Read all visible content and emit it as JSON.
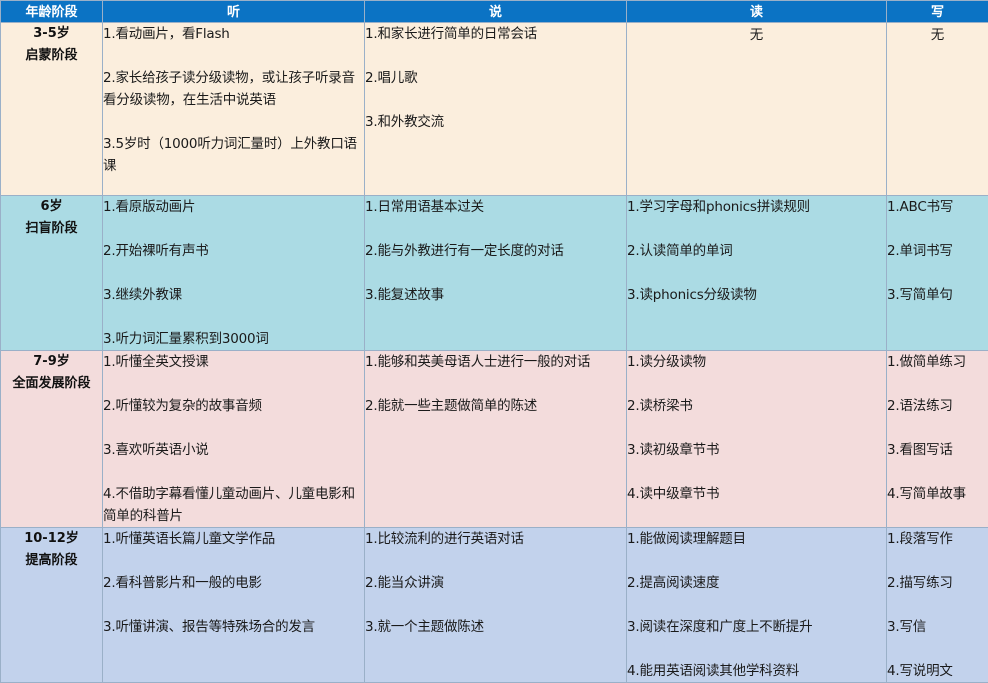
{
  "header": [
    "年龄阶段",
    "听",
    "说",
    "读",
    "写"
  ],
  "rows": [
    {
      "stage": [
        "3-5岁",
        "启蒙阶段"
      ],
      "listen": [
        "1.看动画片，看Flash",
        "2.家长给孩子读分级读物，或让孩子听录音看分级读物，在生活中说英语",
        "3.5岁时（1000听力词汇量时）上外教口语课"
      ],
      "speak": [
        "1.和家长进行简单的日常会话",
        "2.唱儿歌",
        "3.和外教交流"
      ],
      "read": [
        "无"
      ],
      "write": [
        "无"
      ]
    },
    {
      "stage": [
        "6岁",
        "扫盲阶段"
      ],
      "listen": [
        "1.看原版动画片",
        "2.开始裸听有声书",
        "3.继续外教课",
        "3.听力词汇量累积到3000词"
      ],
      "speak": [
        "1.日常用语基本过关",
        "2.能与外教进行有一定长度的对话",
        "3.能复述故事"
      ],
      "read": [
        "1.学习字母和phonics拼读规则",
        "2.认读简单的单词",
        "3.读phonics分级读物"
      ],
      "write": [
        "1.ABC书写",
        "2.单词书写",
        "3.写简单句"
      ]
    },
    {
      "stage": [
        "7-9岁",
        "全面发展阶段"
      ],
      "listen": [
        "1.听懂全英文授课",
        "2.听懂较为复杂的故事音频",
        "3.喜欢听英语小说",
        "4.不借助字幕看懂儿童动画片、儿童电影和简单的科普片"
      ],
      "speak": [
        "1.能够和英美母语人士进行一般的对话",
        "2.能就一些主题做简单的陈述"
      ],
      "read": [
        "1.读分级读物",
        "2.读桥梁书",
        "3.读初级章节书",
        "4.读中级章节书"
      ],
      "write": [
        "1.做简单练习",
        "2.语法练习",
        "3.看图写话",
        "4.写简单故事"
      ]
    },
    {
      "stage": [
        "10-12岁",
        "提高阶段"
      ],
      "listen": [
        "1.听懂英语长篇儿童文学作品",
        "2.看科普影片和一般的电影",
        "3.听懂讲演、报告等特殊场合的发言"
      ],
      "speak": [
        "1.比较流利的进行英语对话",
        "2.能当众讲演",
        "3.就一个主题做陈述"
      ],
      "read": [
        "1.能做阅读理解题目",
        "2.提高阅读速度",
        "3.阅读在深度和广度上不断提升",
        "4.能用英语阅读其他学科资料"
      ],
      "write": [
        "1.段落写作",
        "2.描写练习",
        "3.写信",
        "4.写说明文"
      ]
    }
  ]
}
